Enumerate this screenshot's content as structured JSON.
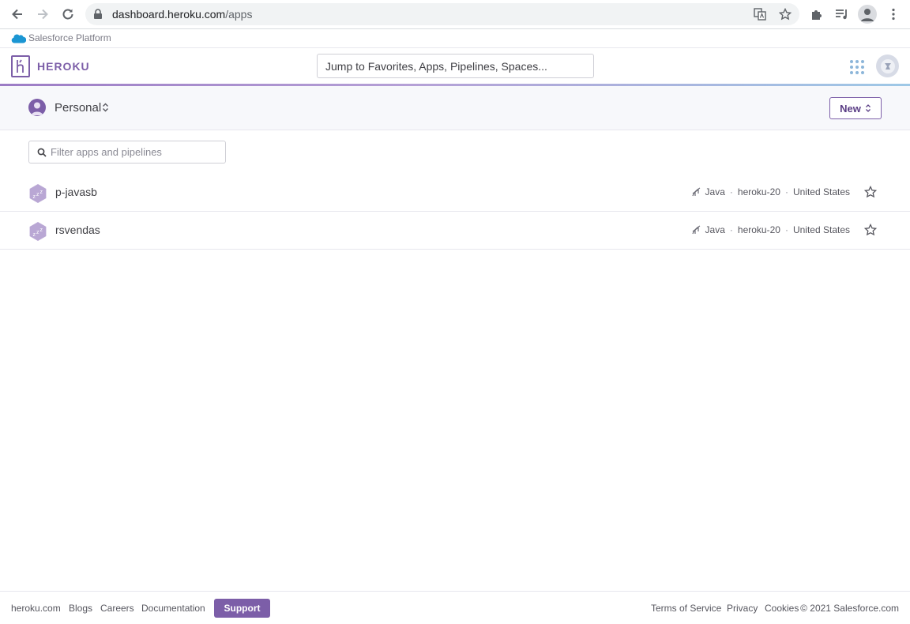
{
  "browser": {
    "url_host": "dashboard.heroku.com",
    "url_path": "/apps"
  },
  "platform_bar": {
    "label": "Salesforce Platform"
  },
  "header": {
    "brand": "HEROKU",
    "search_placeholder": "Jump to Favorites, Apps, Pipelines, Spaces..."
  },
  "account": {
    "name": "Personal",
    "new_label": "New"
  },
  "filter": {
    "placeholder": "Filter apps and pipelines"
  },
  "apps": [
    {
      "name": "p-javasb",
      "language": "Java",
      "stack": "heroku-20",
      "region": "United States"
    },
    {
      "name": "rsvendas",
      "language": "Java",
      "stack": "heroku-20",
      "region": "United States"
    }
  ],
  "meta_separator": "·",
  "footer": {
    "links": [
      "heroku.com",
      "Blogs",
      "Careers",
      "Documentation"
    ],
    "support_label": "Support",
    "right_links": [
      "Terms of Service",
      "Privacy",
      "Cookies"
    ],
    "copyright": "© 2021 Salesforce.com"
  },
  "colors": {
    "brand_purple": "#7c5ea8",
    "accent_blue": "#9ec8e6"
  }
}
